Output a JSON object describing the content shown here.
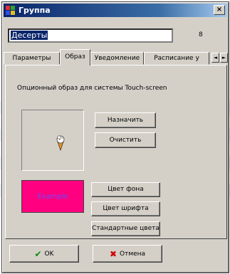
{
  "window": {
    "title": "Группа",
    "close": "×"
  },
  "name_field": {
    "value": "Десерты",
    "count": "8"
  },
  "tabs": [
    {
      "label": "Параметры"
    },
    {
      "label": "Образ"
    },
    {
      "label": "Уведомление"
    },
    {
      "label": "Расписание у"
    }
  ],
  "tab_scroll": {
    "left": "◄",
    "right": "►"
  },
  "panel": {
    "caption": "Опционный образ для системы Touch-screen",
    "assign_label": "Назначить",
    "clear_label": "Очистить",
    "example_label": "Example",
    "bg_color_label": "Цвет фона",
    "font_color_label": "Цвет шрифта",
    "default_colors_label": "Стандартные цвета"
  },
  "footer": {
    "ok_label": "OK",
    "cancel_label": "Отмена"
  },
  "colors": {
    "example_bg": "#ff0080",
    "example_text": "#6a4bff",
    "titlebar": "#0a246a"
  },
  "icons": {
    "app": "app-icon",
    "ok": "checkmark-icon",
    "cancel": "x-icon",
    "image": "ice-cream-icon"
  }
}
